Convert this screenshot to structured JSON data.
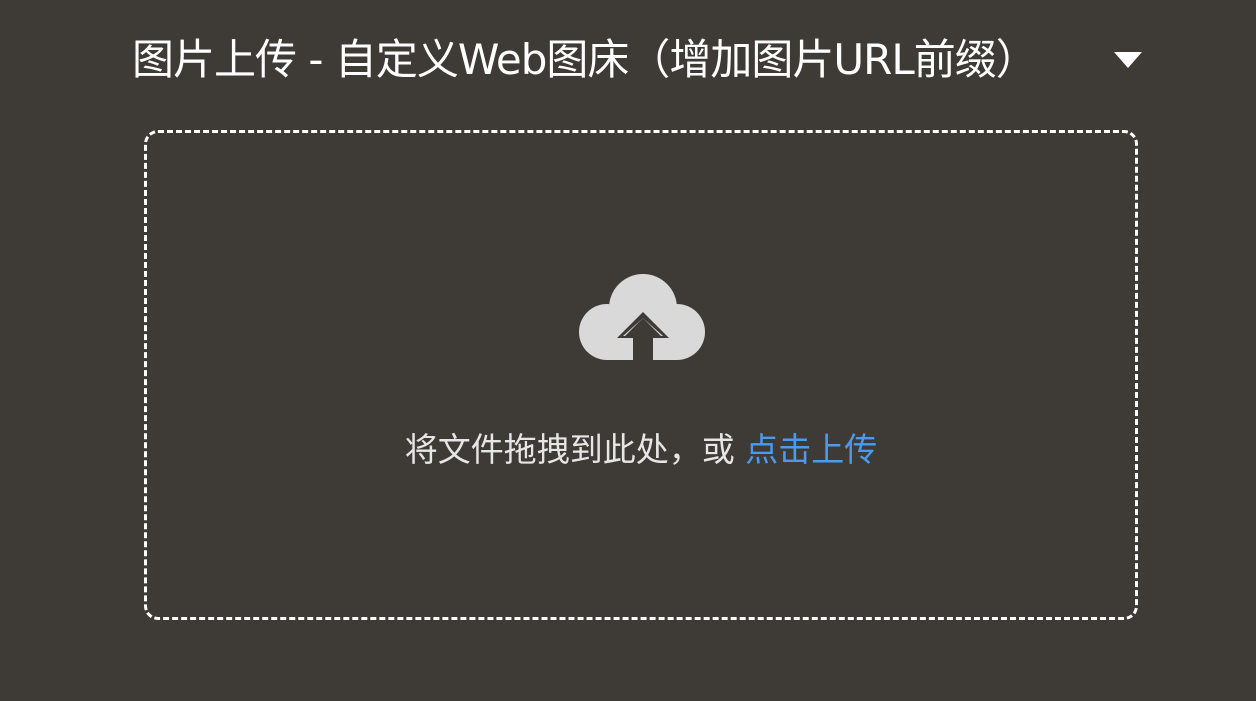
{
  "header": {
    "title": "图片上传 - 自定义Web图床（增加图片URL前缀）",
    "dropdown_icon": "triangle-down-icon"
  },
  "dropzone": {
    "icon": "cloud-upload-icon",
    "hint_text": "将文件拖拽到此处，或 ",
    "link_text": "点击上传"
  },
  "colors": {
    "background": "#3e3b37",
    "text": "#ffffff",
    "link": "#4a9bf0",
    "icon": "#d9d9d9"
  }
}
